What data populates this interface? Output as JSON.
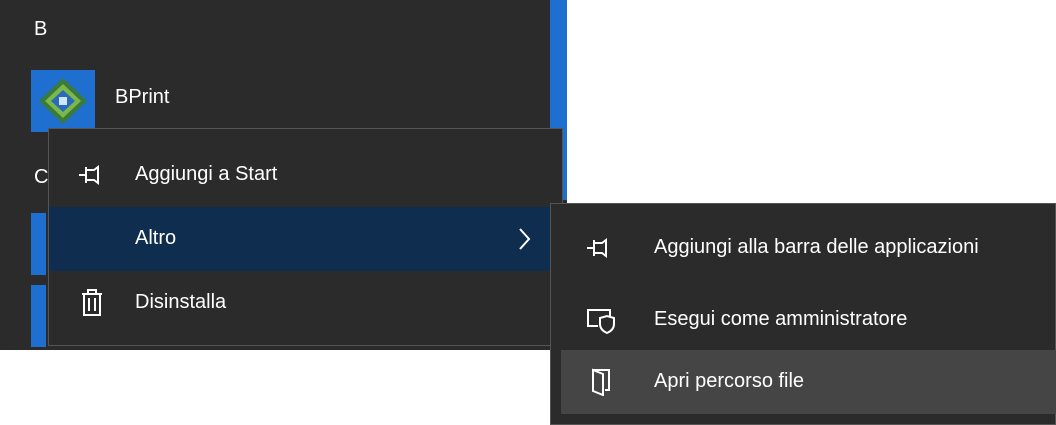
{
  "start_list": {
    "group_b": "B",
    "group_c": "C",
    "app_name": "BPrint",
    "app_icon": "bprint-icon"
  },
  "context_menu": {
    "items": [
      {
        "label": "Aggiungi a Start",
        "icon": "pin-icon"
      },
      {
        "label": "Altro",
        "icon": "",
        "has_submenu": true
      },
      {
        "label": "Disinstalla",
        "icon": "trash-icon"
      }
    ]
  },
  "submenu": {
    "items": [
      {
        "label": "Aggiungi alla barra delle applicazioni",
        "icon": "pin-icon"
      },
      {
        "label": "Esegui come amministratore",
        "icon": "admin-shield-icon"
      },
      {
        "label": "Apri percorso file",
        "icon": "open-folder-icon"
      }
    ]
  },
  "colors": {
    "menu_bg": "#2b2b2b",
    "accent_tile": "#1e6fd0",
    "selected_bg": "#0f2d4f",
    "hover_bg": "#454545"
  }
}
